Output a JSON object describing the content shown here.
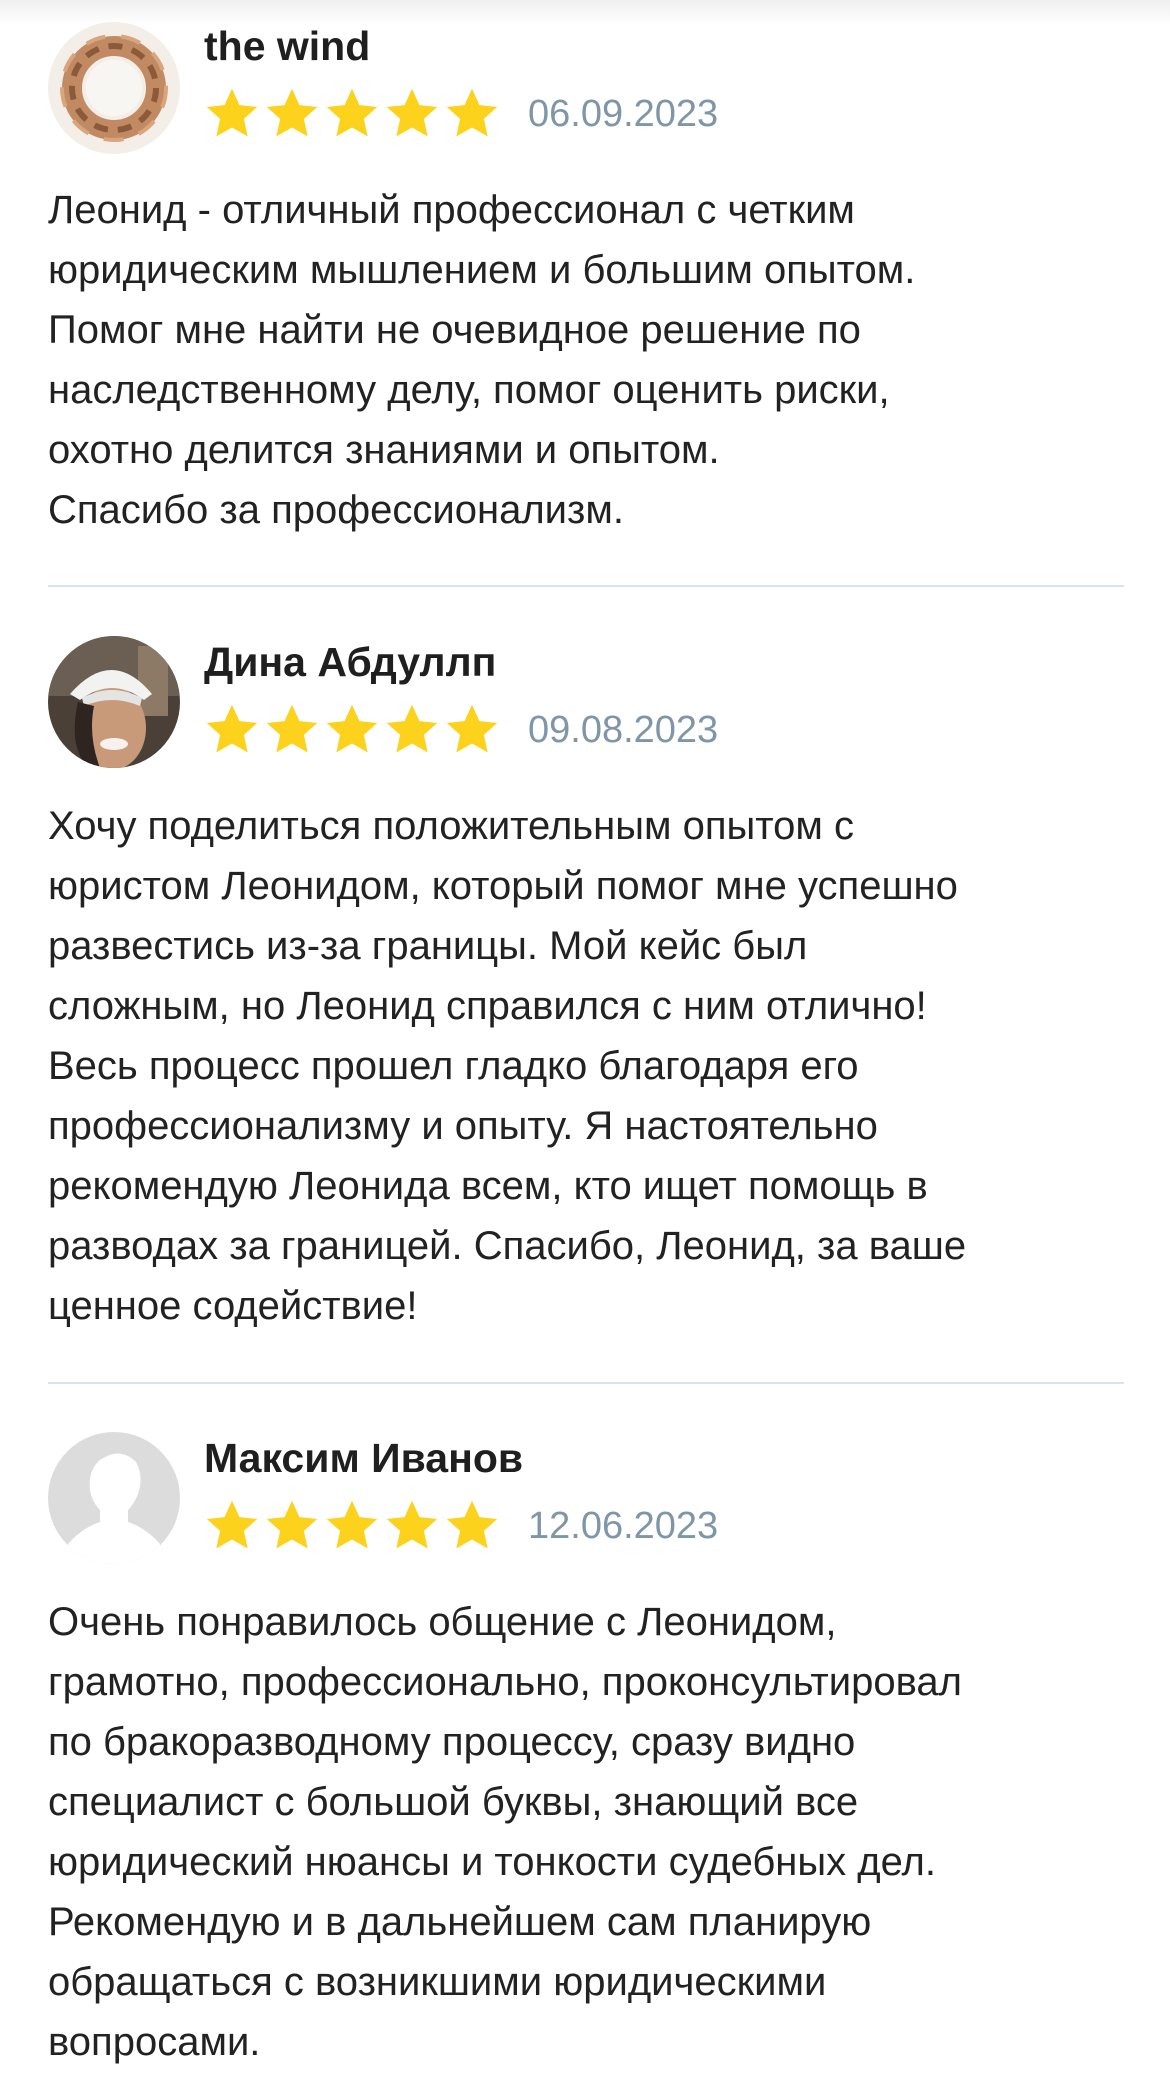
{
  "reviews": [
    {
      "author": "the wind",
      "date": "06.09.2023",
      "rating": 5,
      "avatar": "hands-circle-photo",
      "text_lines": [
        "Леонид - отличный профессионал с четким",
        "юридическим мышлением и большим опытом.",
        "Помог мне найти не очевидное решение по",
        "наследственному делу, помог оценить риски,",
        "охотно делится знаниями и опытом.",
        "Спасибо за профессионализм."
      ]
    },
    {
      "author": "Дина Абдуллп",
      "date": "09.08.2023",
      "rating": 5,
      "avatar": "woman-in-white-hat-photo",
      "text_lines": [
        "Хочу поделиться положительным опытом с",
        "юристом Леонидом, который помог мне успешно",
        "развестись из-за границы. Мой кейс был",
        "сложным, но Леонид справился с ним отлично!",
        "Весь процесс прошел гладко благодаря его",
        "профессионализму и опыту. Я настоятельно",
        "рекомендую Леонида всем, кто ищет помощь в",
        "разводах за границей. Спасибо, Леонид, за ваше",
        "ценное содействие!"
      ]
    },
    {
      "author": "Максим Иванов",
      "date": "12.06.2023",
      "rating": 5,
      "avatar": "default-user-silhouette",
      "text_lines": [
        "Очень понравилось общение с Леонидом,",
        "грамотно, профессионально, проконсультировал",
        "по бракоразводному процессу, сразу видно",
        "специалист с большой буквы, знающий все",
        "юридический нюансы и тонкости судебных дел.",
        "Рекомендую и в дальнейшем сам планирую",
        "обращаться с возникшими юридическими",
        "вопросами."
      ]
    }
  ],
  "colors": {
    "star": "#fcd21d",
    "date": "#7f95a8",
    "divider": "#d9e3ec",
    "text": "#222222"
  }
}
